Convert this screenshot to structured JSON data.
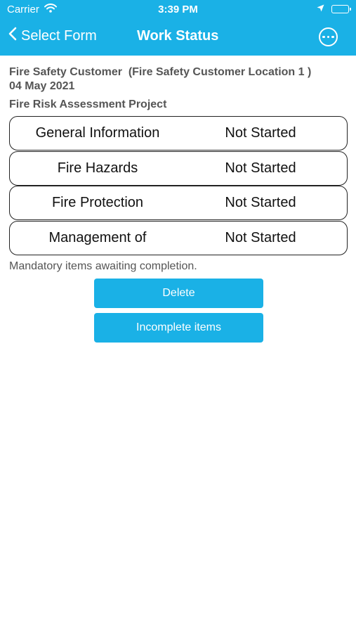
{
  "status_bar": {
    "carrier": "Carrier",
    "time": "3:39 PM"
  },
  "nav": {
    "back_label": "Select Form",
    "title": "Work Status"
  },
  "info": {
    "customer_line": "Fire Safety Customer  (Fire Safety Customer Location 1 )",
    "date": "04 May 2021",
    "project": "Fire Risk Assessment Project"
  },
  "sections": [
    {
      "name": "General Information",
      "status": "Not Started"
    },
    {
      "name": "Fire Hazards",
      "status": "Not Started"
    },
    {
      "name": "Fire Protection",
      "status": "Not Started"
    },
    {
      "name": "Management of",
      "status": "Not Started"
    }
  ],
  "mandatory_note": "Mandatory items awaiting completion.",
  "buttons": {
    "delete": "Delete",
    "incomplete": "Incomplete items"
  },
  "colors": {
    "accent": "#1ab1e6"
  }
}
